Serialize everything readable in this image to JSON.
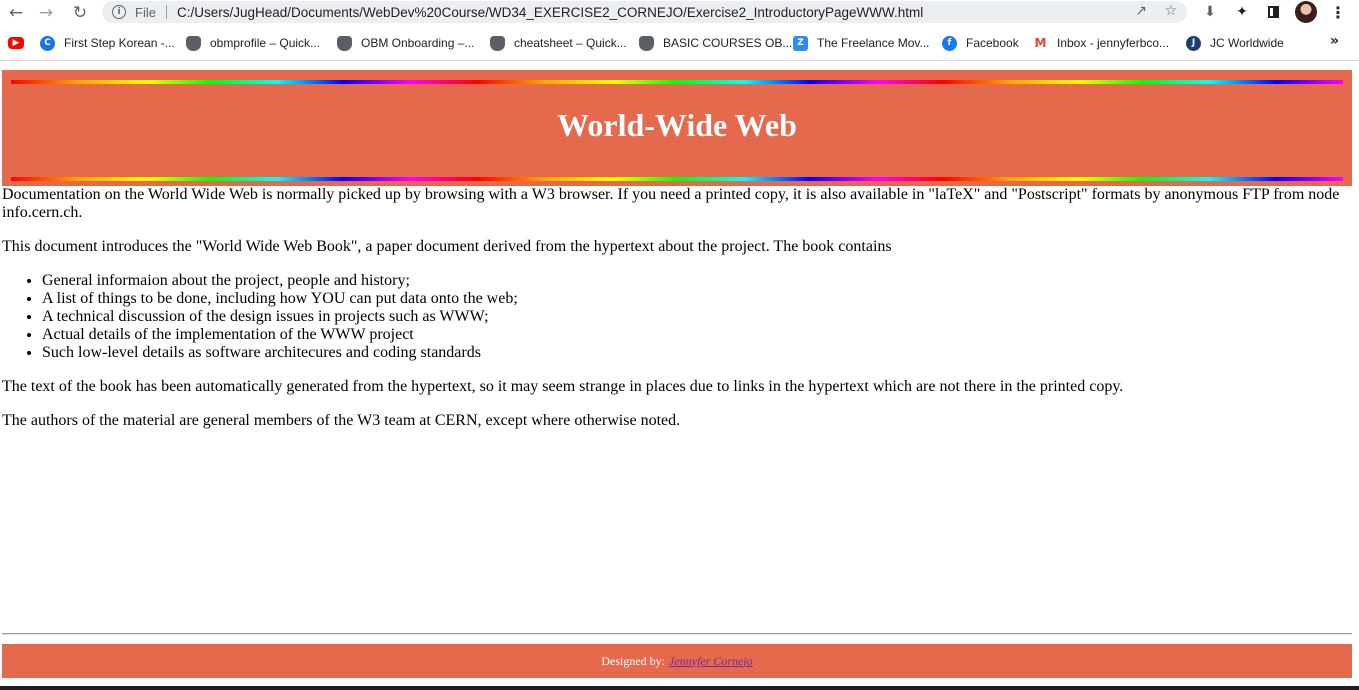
{
  "browser": {
    "scheme_label": "File",
    "url": "C:/Users/JugHead/Documents/WebDev%20Course/WD34_EXERCISE2_CORNEJO/Exercise2_IntroductoryPageWWW.html",
    "more_bookmarks": "»"
  },
  "bookmarks": [
    {
      "label": "",
      "icon": "youtube-icon"
    },
    {
      "label": "First Step Korean -...",
      "icon": "coursera-icon"
    },
    {
      "label": "obmprofile – Quick...",
      "icon": "shield-icon"
    },
    {
      "label": "OBM Onboarding –...",
      "icon": "shield-icon"
    },
    {
      "label": "cheatsheet – Quick...",
      "icon": "shield-icon"
    },
    {
      "label": "BASIC COURSES OB...",
      "icon": "shield-icon"
    },
    {
      "label": "The Freelance Mov...",
      "icon": "freelance-icon"
    },
    {
      "label": "Facebook",
      "icon": "facebook-icon"
    },
    {
      "label": "Inbox - jennyferbco...",
      "icon": "gmail-icon"
    },
    {
      "label": "JC Worldwide",
      "icon": "jc-icon"
    }
  ],
  "page": {
    "title": "World-Wide Web",
    "paragraphs": [
      "Documentation on the World Wide Web is normally picked up by browsing with a W3 browser. If you need a printed copy, it is also available in \"laTeX\" and \"Postscript\" formats by anonymous FTP from node info.cern.ch.",
      "This document introduces the \"World Wide Web Book\", a paper document derived from the hypertext about the project. The book contains"
    ],
    "list_items": [
      "General informaion about the project, people and history;",
      "A list of things to be done, including how YOU can put data onto the web;",
      "A technical discussion of the design issues in projects such as WWW;",
      "Actual details of the implementation of the WWW project",
      "Such low-level details as software architecures and coding standards"
    ],
    "paragraphs_after": [
      "The text of the book has been automatically generated from the hypertext, so it may seem strange in places due to links in the hypertext which are not there in the printed copy.",
      "The authors of the material are general members of the W3 team at CERN, except where otherwise noted."
    ],
    "footer": {
      "prefix": "Designed by:",
      "author": "Jennyfer Cornejo"
    }
  },
  "colors": {
    "banner": "#e4694d",
    "link": "#6b2fa0"
  }
}
